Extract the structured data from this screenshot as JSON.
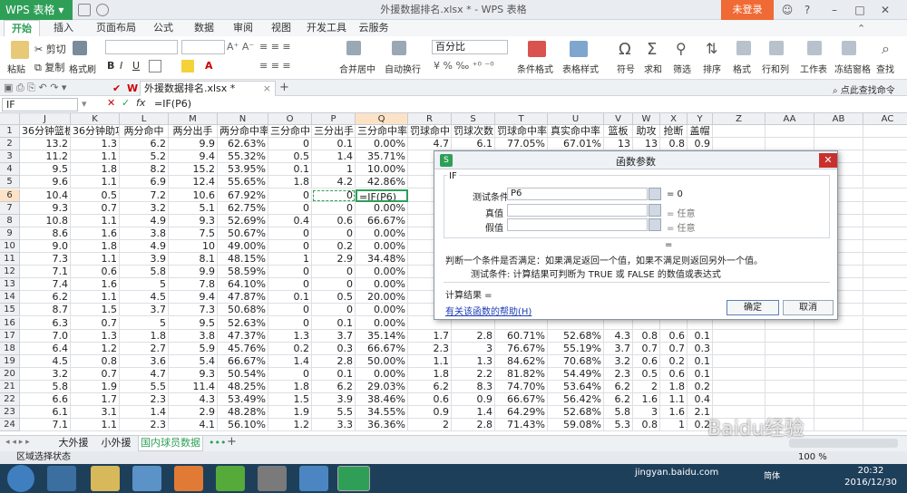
{
  "app": {
    "logo": "WPS 表格",
    "title": "外援数据排名.xlsx * - WPS 表格",
    "login": "未登录"
  },
  "menu": {
    "tabs": [
      "开始",
      "插入",
      "页面布局",
      "公式",
      "数据",
      "审阅",
      "视图",
      "开发工具",
      "云服务"
    ]
  },
  "ribbon": {
    "paste": "粘贴",
    "cut": "剪切",
    "copy": "复制",
    "format_painter": "格式刷",
    "merge": "合并居中",
    "wrap": "自动换行",
    "number_format": "百分比",
    "cond_format": "条件格式",
    "table_style": "表格样式",
    "symbol": "符号",
    "sum": "求和",
    "filter": "筛选",
    "sort": "排序",
    "format": "格式",
    "rowcol": "行和列",
    "sheet": "工作表",
    "freeze": "冻结窗格",
    "find": "查找"
  },
  "tabbar": {
    "doc_tab": "外援数据排名.xlsx *",
    "search": "点此查找命令"
  },
  "formula": {
    "name_box": "IF",
    "fx": "fx",
    "content": "=IF(P6)"
  },
  "grid": {
    "columns": [
      "J",
      "K",
      "L",
      "M",
      "N",
      "O",
      "P",
      "Q",
      "R",
      "S",
      "T",
      "U",
      "V",
      "W",
      "X",
      "Y",
      "Z",
      "AA",
      "AB",
      "AC"
    ],
    "row_numbers": [
      "1",
      "2",
      "3",
      "4",
      "5",
      "6",
      "7",
      "8",
      "9",
      "10",
      "11",
      "12",
      "13",
      "14",
      "15",
      "16",
      "17",
      "18",
      "19",
      "20",
      "21",
      "22",
      "23",
      "24"
    ],
    "rows": [
      [
        "36分钟篮板",
        "36分钟助攻",
        "两分命中",
        "两分出手",
        "两分命中率",
        "三分命中",
        "三分出手",
        "三分命中率",
        "罚球命中",
        "罚球次数",
        "罚球命中率",
        "真实命中率",
        "篮板",
        "助攻",
        "抢断",
        "盖帽"
      ],
      [
        "13.2",
        "1.3",
        "6.2",
        "9.9",
        "62.63%",
        "0",
        "0.1",
        "0.00%",
        "4.7",
        "6.1",
        "77.05%",
        "67.01%",
        "13",
        "13",
        "0.8",
        "0.9"
      ],
      [
        "11.2",
        "1.1",
        "5.2",
        "9.4",
        "55.32%",
        "0.5",
        "1.4",
        "35.71%",
        "",
        "",
        "",
        "",
        "",
        "",
        "",
        ""
      ],
      [
        "9.5",
        "1.8",
        "8.2",
        "15.2",
        "53.95%",
        "0.1",
        "1",
        "10.00%",
        "",
        "",
        "",
        "",
        "",
        "",
        "",
        ""
      ],
      [
        "9.6",
        "1.1",
        "6.9",
        "12.4",
        "55.65%",
        "1.8",
        "4.2",
        "42.86%",
        "",
        "",
        "",
        "",
        "",
        "",
        "",
        ""
      ],
      [
        "10.4",
        "0.5",
        "7.2",
        "10.6",
        "67.92%",
        "0",
        "0",
        "=IF(P6)",
        "",
        "",
        "",
        "",
        "",
        "",
        "",
        ""
      ],
      [
        "9.3",
        "0.7",
        "3.2",
        "5.1",
        "62.75%",
        "0",
        "0",
        "0.00%",
        "",
        "",
        "",
        "",
        "",
        "",
        "",
        ""
      ],
      [
        "10.8",
        "1.1",
        "4.9",
        "9.3",
        "52.69%",
        "0.4",
        "0.6",
        "66.67%",
        "",
        "",
        "",
        "",
        "",
        "",
        "",
        ""
      ],
      [
        "8.6",
        "1.6",
        "3.8",
        "7.5",
        "50.67%",
        "0",
        "0",
        "0.00%",
        "",
        "",
        "",
        "",
        "",
        "",
        "",
        ""
      ],
      [
        "9.0",
        "1.8",
        "4.9",
        "10",
        "49.00%",
        "0",
        "0.2",
        "0.00%",
        "",
        "",
        "",
        "",
        "",
        "",
        "",
        ""
      ],
      [
        "7.3",
        "1.1",
        "3.9",
        "8.1",
        "48.15%",
        "1",
        "2.9",
        "34.48%",
        "",
        "",
        "",
        "",
        "",
        "",
        "",
        ""
      ],
      [
        "7.1",
        "0.6",
        "5.8",
        "9.9",
        "58.59%",
        "0",
        "0",
        "0.00%",
        "",
        "",
        "",
        "",
        "",
        "",
        "",
        ""
      ],
      [
        "7.4",
        "1.6",
        "5",
        "7.8",
        "64.10%",
        "0",
        "0",
        "0.00%",
        "",
        "",
        "",
        "",
        "",
        "",
        "",
        ""
      ],
      [
        "6.2",
        "1.1",
        "4.5",
        "9.4",
        "47.87%",
        "0.1",
        "0.5",
        "20.00%",
        "",
        "",
        "",
        "",
        "",
        "",
        "",
        ""
      ],
      [
        "8.7",
        "1.5",
        "3.7",
        "7.3",
        "50.68%",
        "0",
        "0",
        "0.00%",
        "",
        "",
        "",
        "",
        "",
        "",
        "",
        ""
      ],
      [
        "6.3",
        "0.7",
        "5",
        "9.5",
        "52.63%",
        "0",
        "0.1",
        "0.00%",
        "",
        "",
        "",
        "",
        "",
        "",
        "",
        ""
      ],
      [
        "7.0",
        "1.3",
        "1.8",
        "3.8",
        "47.37%",
        "1.3",
        "3.7",
        "35.14%",
        "1.7",
        "2.8",
        "60.71%",
        "52.68%",
        "4.3",
        "0.8",
        "0.6",
        "0.1"
      ],
      [
        "6.4",
        "1.2",
        "2.7",
        "5.9",
        "45.76%",
        "0.2",
        "0.3",
        "66.67%",
        "2.3",
        "3",
        "76.67%",
        "55.19%",
        "3.7",
        "0.7",
        "0.7",
        "0.3"
      ],
      [
        "4.5",
        "0.8",
        "3.6",
        "5.4",
        "66.67%",
        "1.4",
        "2.8",
        "50.00%",
        "1.1",
        "1.3",
        "84.62%",
        "70.68%",
        "3.2",
        "0.6",
        "0.2",
        "0.1"
      ],
      [
        "3.2",
        "0.7",
        "4.7",
        "9.3",
        "50.54%",
        "0",
        "0.1",
        "0.00%",
        "1.8",
        "2.2",
        "81.82%",
        "54.49%",
        "2.3",
        "0.5",
        "0.6",
        "0.1"
      ],
      [
        "5.8",
        "1.9",
        "5.5",
        "11.4",
        "48.25%",
        "1.8",
        "6.2",
        "29.03%",
        "6.2",
        "8.3",
        "74.70%",
        "53.64%",
        "6.2",
        "2",
        "1.8",
        "0.2"
      ],
      [
        "6.6",
        "1.7",
        "2.3",
        "4.3",
        "53.49%",
        "1.5",
        "3.9",
        "38.46%",
        "0.6",
        "0.9",
        "66.67%",
        "56.42%",
        "6.2",
        "1.6",
        "1.1",
        "0.4"
      ],
      [
        "6.1",
        "3.1",
        "1.4",
        "2.9",
        "48.28%",
        "1.9",
        "5.5",
        "34.55%",
        "0.9",
        "1.4",
        "64.29%",
        "52.68%",
        "5.8",
        "3",
        "1.6",
        "2.1"
      ],
      [
        "7.1",
        "1.1",
        "2.3",
        "4.1",
        "56.10%",
        "1.2",
        "3.3",
        "36.36%",
        "2",
        "2.8",
        "71.43%",
        "59.08%",
        "5.3",
        "0.8",
        "1",
        "0.2"
      ]
    ]
  },
  "dialog": {
    "title": "函数参数",
    "func": "IF",
    "arg1_label": "测试条件",
    "arg1_value": "P6",
    "arg1_result": "= 0",
    "arg2_label": "真值",
    "arg2_result": "= 任意",
    "arg3_label": "假值",
    "arg3_result": "= 任意",
    "eq": "=",
    "desc": "判断一个条件是否满足：如果满足返回一个值，如果不满足则返回另外一个值。",
    "arg_desc": "测试条件:   计算结果可判断为 TRUE 或 FALSE 的数值或表达式",
    "calc_result": "计算结果 =",
    "help_link": "有关该函数的帮助(H)",
    "ok": "确定",
    "cancel": "取消"
  },
  "sheets": {
    "tabs": [
      "大外援",
      "小外援",
      "国内球员数据"
    ],
    "active": 2,
    "more": "•••",
    "add": "+"
  },
  "status": {
    "mode": "区域选择状态",
    "zoom": "100 %",
    "lang": "简体",
    "time": "20:32",
    "date": "2016/12/30",
    "watermark": "jingyan.baidu.com",
    "watermark_logo": "Baidu经验"
  },
  "colors": {
    "wps_green": "#2f9f58",
    "login_orange": "#f06a35",
    "dialog_close": "#c9302c",
    "link_blue": "#1a3cb5"
  }
}
